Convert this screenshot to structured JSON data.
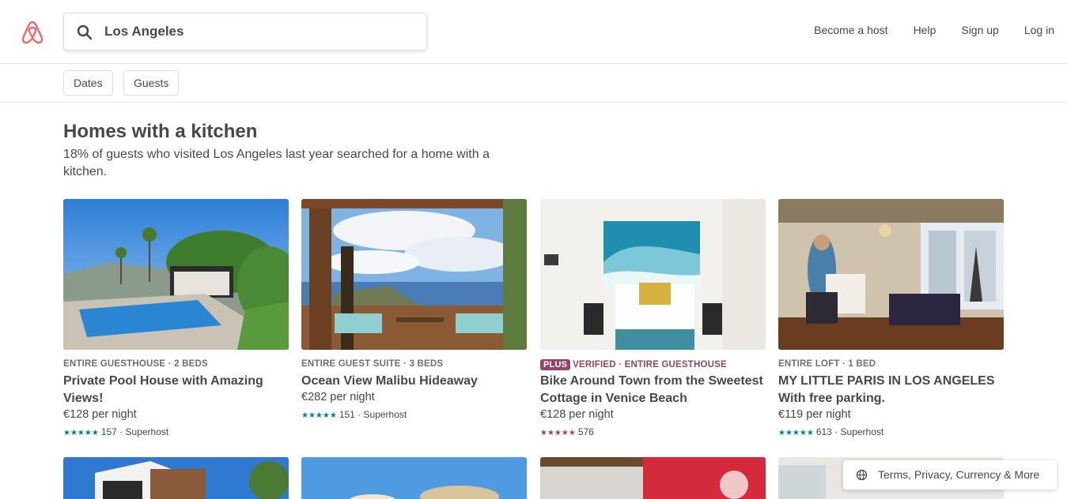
{
  "header": {
    "logo": "airbnb-logo-icon",
    "search": {
      "value": "Los Angeles",
      "icon": "search-icon"
    },
    "nav": [
      "Become a host",
      "Help",
      "Sign up",
      "Log in"
    ]
  },
  "filters": [
    "Dates",
    "Guests"
  ],
  "section": {
    "title": "Homes with a kitchen",
    "subtitle": "18% of guests who visited Los Angeles last year searched for a home with a kitchen."
  },
  "listings": [
    {
      "kicker": "ENTIRE GUESTHOUSE · 2 BEDS",
      "title": "Private Pool House with Amazing Views!",
      "price": "€128 per night",
      "stars": "★★★★★",
      "rating": "157 · Superhost"
    },
    {
      "kicker": "ENTIRE GUEST SUITE · 3 BEDS",
      "title": "Ocean View Malibu Hideaway",
      "price": "€282 per night",
      "stars": "★★★★★",
      "rating": "151 · Superhost"
    },
    {
      "plus_badge": "PLUS",
      "kicker": "VERIFIED · ENTIRE GUESTHOUSE",
      "title": "Bike Around Town from the Sweetest Cottage in Venice Beach",
      "price": "€128 per night",
      "stars": "★★★★★",
      "rating": "576"
    },
    {
      "kicker": "ENTIRE LOFT · 1 BED",
      "title": "MY LITTLE PARIS IN LOS ANGELES With free parking.",
      "price": "€119 per night",
      "stars": "★★★★★",
      "rating": "613 · Superhost"
    }
  ],
  "footer": {
    "text": "Terms, Privacy, Currency & More",
    "icon": "globe-icon"
  },
  "colors": {
    "brand": "#FF5A5F",
    "teal": "#008489",
    "plus": "#914669"
  }
}
